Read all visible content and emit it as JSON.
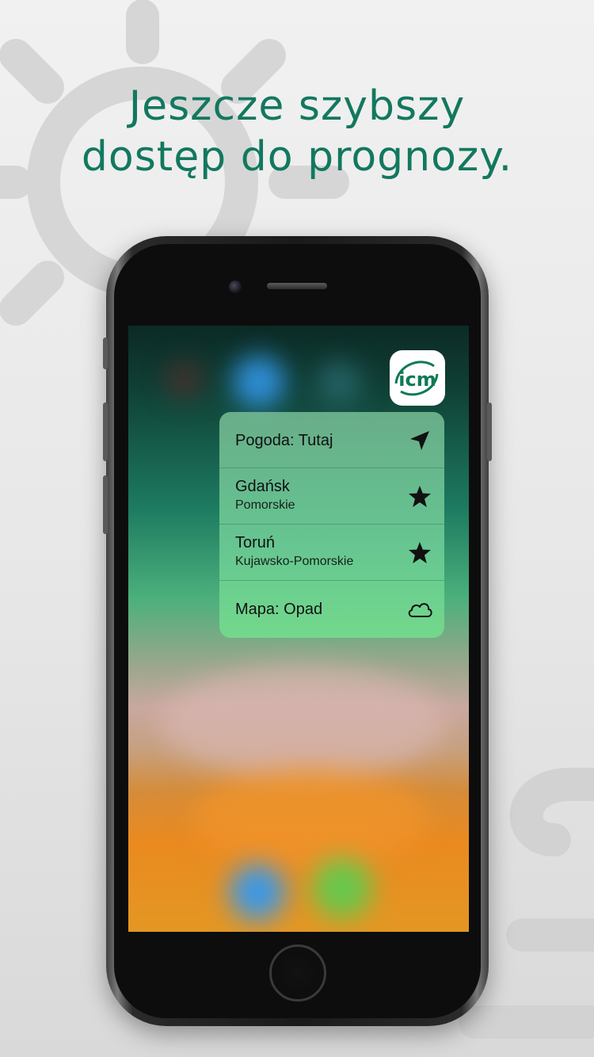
{
  "headline": {
    "line1": "Jeszcze szybszy",
    "line2": "dostęp do prognozy.",
    "color": "#12785f"
  },
  "app_icon": {
    "name": "icm-app-icon",
    "text": "icm",
    "color": "#0f7a55"
  },
  "quick_actions": [
    {
      "title": "Pogoda: Tutaj",
      "subtitle": "",
      "icon": "location-arrow-icon"
    },
    {
      "title": "Gdańsk",
      "subtitle": "Pomorskie",
      "icon": "star-icon"
    },
    {
      "title": "Toruń",
      "subtitle": "Kujawsko-Pomorskie",
      "icon": "star-icon"
    },
    {
      "title": "Mapa: Opad",
      "subtitle": "",
      "icon": "cloud-icon"
    }
  ],
  "colors": {
    "brand_green": "#12785f",
    "menu_text": "#111111"
  }
}
